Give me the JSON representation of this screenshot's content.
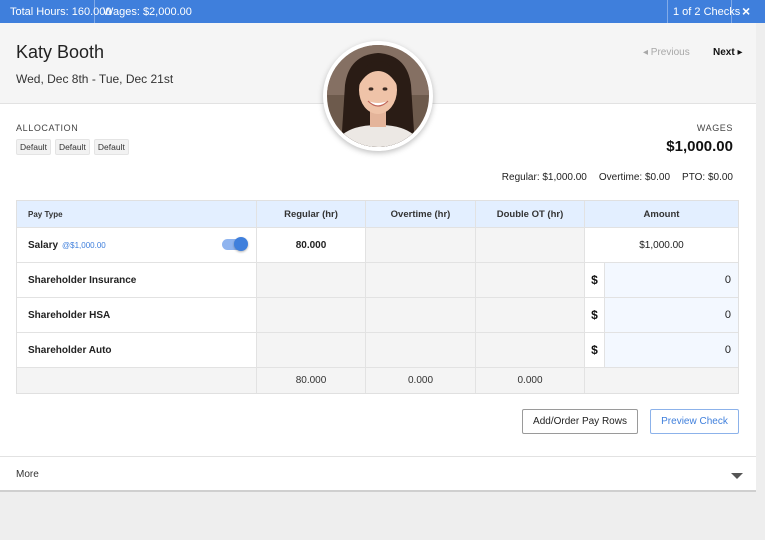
{
  "topbar": {
    "total_hours": "Total Hours: 160.000",
    "wages": "Wages: $2,000.00",
    "checks_counter": "1 of 2 Checks",
    "close_icon": "×"
  },
  "header": {
    "employee_name": "Katy Booth",
    "date_range": "Wed, Dec 8th - Tue, Dec 21st",
    "previous_label": "◂ Previous",
    "next_label": "Next ▸",
    "avatar_icon": "employee-photo"
  },
  "allocation": {
    "title": "ALLOCATION",
    "chips": [
      "Default",
      "Default",
      "Default"
    ]
  },
  "wages": {
    "title": "WAGES",
    "amount": "$1,000.00",
    "regular": "Regular: $1,000.00",
    "overtime": "Overtime: $0.00",
    "pto": "PTO: $0.00"
  },
  "table": {
    "headers": {
      "pay_type": "Pay Type",
      "regular": "Regular (hr)",
      "overtime": "Overtime (hr)",
      "double_ot": "Double OT (hr)",
      "amount": "Amount"
    },
    "salary": {
      "label": "Salary",
      "rate": "@$1,000.00",
      "regular": "80.000",
      "amount": "$1,000.00",
      "toggle_on": true
    },
    "rows": [
      {
        "label": "Shareholder Insurance",
        "currency": "$",
        "amount": "0"
      },
      {
        "label": "Shareholder HSA",
        "currency": "$",
        "amount": "0"
      },
      {
        "label": "Shareholder Auto",
        "currency": "$",
        "amount": "0"
      }
    ],
    "totals": {
      "regular": "80.000",
      "overtime": "0.000",
      "double_ot": "0.000"
    }
  },
  "actions": {
    "add_order_label": "Add/Order Pay Rows",
    "preview_label": "Preview Check"
  },
  "more": {
    "label": "More"
  },
  "colors": {
    "accent": "#3f7fdc",
    "header_row": "#e3efff"
  }
}
